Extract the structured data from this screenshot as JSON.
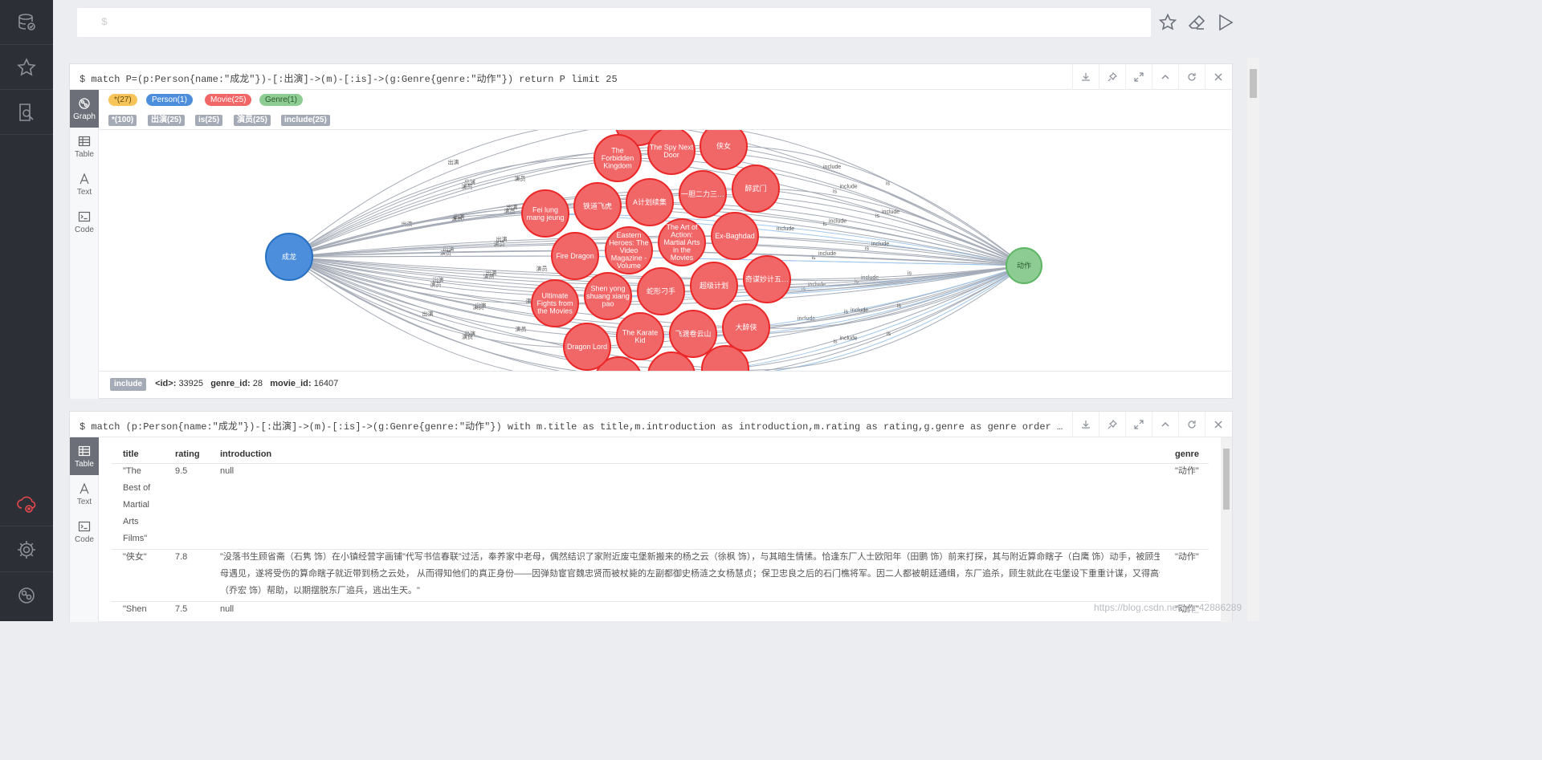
{
  "editor": {
    "prompt": "$"
  },
  "frame1": {
    "query": "$ match P=(p:Person{name:\"成龙\"})-[:出演]->(m)-[:is]->(g:Genre{genre:\"动作\"}) return P limit 25",
    "tabs": [
      "Graph",
      "Table",
      "Text",
      "Code"
    ],
    "node_labels": [
      {
        "text": "*(27)",
        "color": "#f7c45a",
        "fg": "#604a0e"
      },
      {
        "text": "Person(1)",
        "color": "#4c8edb",
        "fg": "#ffffff"
      },
      {
        "text": "Movie(25)",
        "color": "#f16667",
        "fg": "#ffffff"
      },
      {
        "text": "Genre(1)",
        "color": "#8dcc93",
        "fg": "#2a5a2e"
      }
    ],
    "rel_types": [
      "*(100)",
      "出演(25)",
      "is(25)",
      "演员(25)",
      "include(25)"
    ],
    "status": {
      "tag": "include",
      "id_label": "<id>:",
      "id_value": "33925",
      "genre_label": "genre_id:",
      "genre_value": "28",
      "movie_label": "movie_id:",
      "movie_value": "16407"
    }
  },
  "graph": {
    "person": {
      "label": "成龙",
      "color": "#4c8edb"
    },
    "genre": {
      "label": "动作",
      "color": "#8dcc93"
    },
    "movie_color": "#f16667",
    "movies": [
      "The Forbidden Kingdom",
      "The Spy Next Door",
      "侠女",
      "Fei lung mang jeung",
      "铁道飞虎",
      "A计划续集",
      "一胆二力三…",
      "醉武门",
      "Fire Dragon",
      "Eastern Heroes: The Video Magazine - Volume",
      "The Art of Action: Martial Arts in the Movies",
      "Ex-Baghdad",
      "Ultimate Fights from the Movies",
      "Shen yong shuang xiang pao",
      "蛇形刁手",
      "超级计划",
      "奇谋妙计五…",
      "Dragon Lord",
      "The Karate Kid",
      "飞渡卷云山",
      "大醉侠"
    ],
    "rel_left": [
      "演员",
      "出演"
    ],
    "rel_right": [
      "is",
      "include"
    ]
  },
  "frame2": {
    "query": "$ match (p:Person{name:\"成龙\"})-[:出演]->(m)-[:is]->(g:Genre{genre:\"动作\"}) with m.title as title,m.introduction as introduction,m.rating as rating,g.genre as genre order by rating desc return…",
    "tabs": [
      "Table",
      "Text",
      "Code"
    ],
    "columns": [
      "title",
      "rating",
      "introduction",
      "genre"
    ],
    "rows": [
      {
        "title_lines": [
          "\"The",
          "Best of",
          "Martial",
          "Arts",
          "Films\""
        ],
        "rating": "9.5",
        "introduction_lines": [
          "null"
        ],
        "genre": "\"动作\""
      },
      {
        "title_lines": [
          "\"侠女\""
        ],
        "rating": "7.8",
        "introduction_lines": [
          "\"没落书生顾省斋（石隽 饰）在小镇经营字画铺\"代写书信春联\"过活，奉养家中老母，偶然结识了家附近废屯堡新搬来的杨之云（徐枫 饰），与其暗生情愫。恰逢东厂人士欧阳年（田鹏 饰）前来打探，其与附近算命瞎子（白鹰 饰）动手，被顾生与其",
          "母遇见，遂将受伤的算命瞎子就近带到杨之云处， 从而得知他们的真正身份——因弹劾宦官魏忠贤而被杖毙的左副都御史杨涟之女杨慧贞；保卫忠良之后的石门樵将军。因二人都被朝廷通缉，东厂追杀，顾生就此在屯堡设下重重计谋，又得高僧慧圆",
          "（乔宏 饰）帮助，以期摆脱东厂追兵，逃出生天。\""
        ],
        "genre": "\"动作\""
      },
      {
        "title_lines": [
          "\"Shen"
        ],
        "rating": "7.5",
        "introduction_lines": [
          "null"
        ],
        "genre": "\"动作\""
      }
    ]
  },
  "watermark": "https://blog.csdn.net/qq_42886289"
}
